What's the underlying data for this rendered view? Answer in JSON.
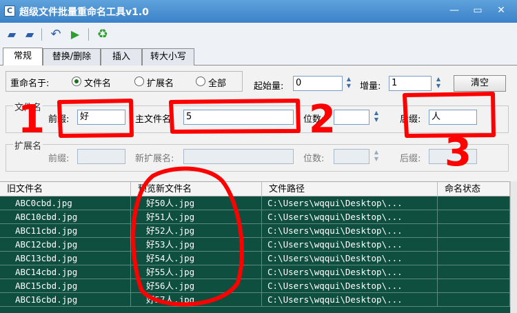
{
  "window": {
    "title": "超级文件批量重命名工具v1.0",
    "controls": [
      "—",
      "▭",
      "✕"
    ]
  },
  "toolbar": {
    "icons": [
      "open-file-icon",
      "open-folder-icon",
      "undo-icon",
      "run-icon",
      "recycle-icon"
    ]
  },
  "tabs": [
    {
      "label": "常规",
      "active": true
    },
    {
      "label": "替换/删除",
      "active": false
    },
    {
      "label": "插入",
      "active": false
    },
    {
      "label": "转大小写",
      "active": false
    }
  ],
  "rename": {
    "label": "重命名于:",
    "options": [
      {
        "label": "文件名",
        "checked": true
      },
      {
        "label": "扩展名",
        "checked": false
      },
      {
        "label": "全部",
        "checked": false
      }
    ],
    "start_label": "起始量:",
    "start_value": "0",
    "step_label": "增量:",
    "step_value": "1",
    "clear_label": "清空"
  },
  "filename_group": {
    "title": "文件名",
    "prefix_label": "前缀:",
    "prefix_value": "好",
    "main_label": "主文件名:",
    "main_value": "5",
    "digits_label": "位数:",
    "digits_value": "",
    "suffix_label": "后缀:",
    "suffix_value": "人"
  },
  "extension_group": {
    "title": "扩展名",
    "prefix_label": "前缀:",
    "prefix_value": "",
    "newext_label": "新扩展名:",
    "newext_value": "",
    "digits_label": "位数:",
    "digits_value": "",
    "suffix_label": "后缀:",
    "suffix_value": ""
  },
  "table": {
    "headers": [
      "旧文件名",
      "预览新文件名",
      "文件路径",
      "命名状态"
    ],
    "rows": [
      {
        "old": "ABC0cbd.jpg",
        "new": "好50人.jpg",
        "path": "C:\\Users\\wqqui\\Desktop\\...",
        "status": ""
      },
      {
        "old": "ABC10cbd.jpg",
        "new": "好51人.jpg",
        "path": "C:\\Users\\wqqui\\Desktop\\...",
        "status": ""
      },
      {
        "old": "ABC11cbd.jpg",
        "new": "好52人.jpg",
        "path": "C:\\Users\\wqqui\\Desktop\\...",
        "status": ""
      },
      {
        "old": "ABC12cbd.jpg",
        "new": "好53人.jpg",
        "path": "C:\\Users\\wqqui\\Desktop\\...",
        "status": ""
      },
      {
        "old": "ABC13cbd.jpg",
        "new": "好54人.jpg",
        "path": "C:\\Users\\wqqui\\Desktop\\...",
        "status": ""
      },
      {
        "old": "ABC14cbd.jpg",
        "new": "好55人.jpg",
        "path": "C:\\Users\\wqqui\\Desktop\\...",
        "status": ""
      },
      {
        "old": "ABC15cbd.jpg",
        "new": "好56人.jpg",
        "path": "C:\\Users\\wqqui\\Desktop\\...",
        "status": ""
      },
      {
        "old": "ABC16cbd.jpg",
        "new": "好57人.jpg",
        "path": "C:\\Users\\wqqui\\Desktop\\...",
        "status": ""
      }
    ]
  },
  "annotations": {
    "numbers": [
      "1",
      "2",
      "3"
    ],
    "color": "#ff0000"
  },
  "colors": {
    "title_bar": "#3b82c8",
    "row_bg": "#0f4f3f",
    "annotation": "#ff0000"
  }
}
